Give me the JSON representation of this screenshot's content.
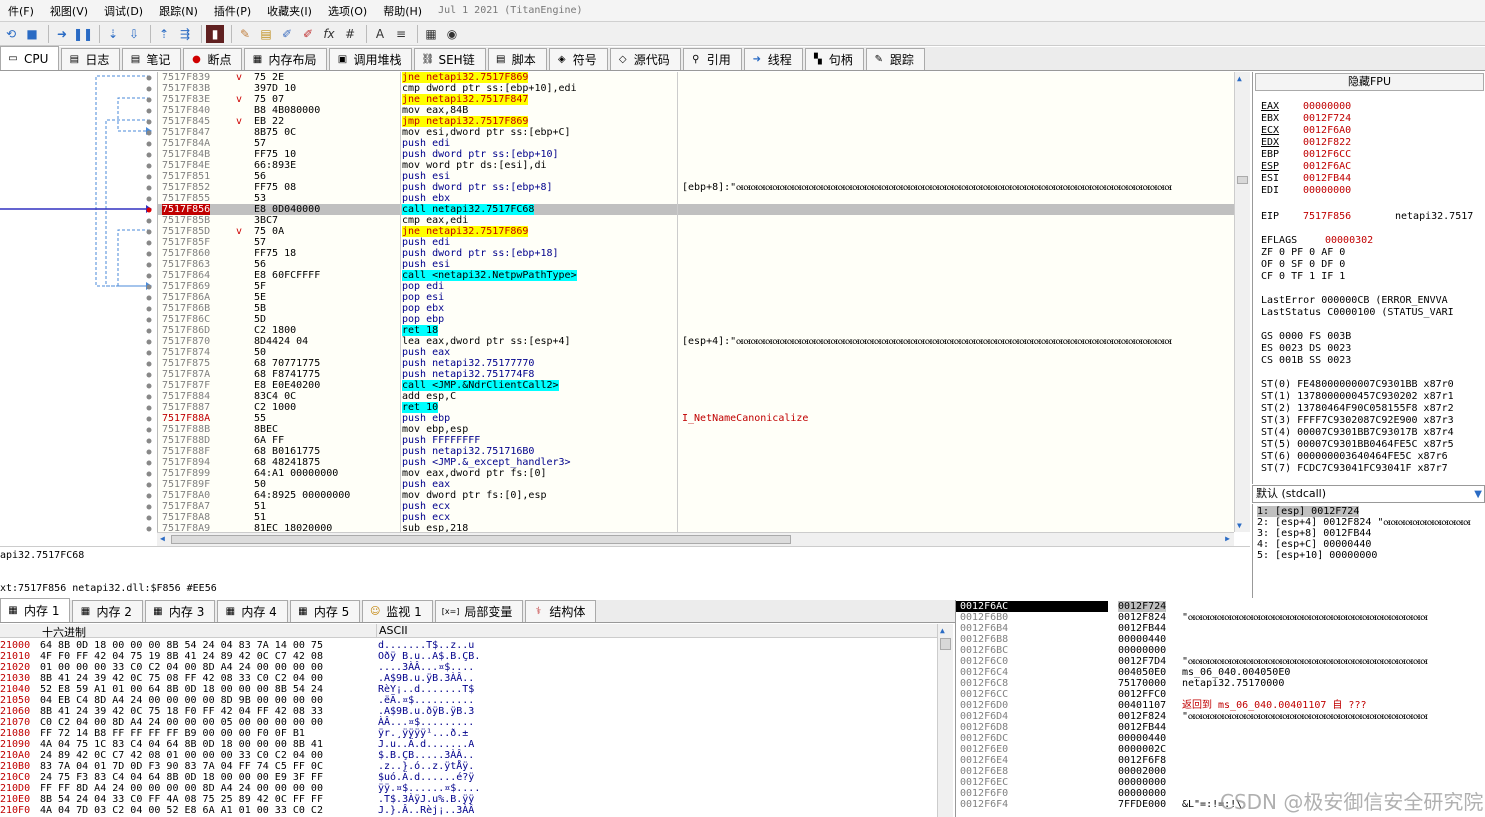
{
  "menu": [
    "件(F)",
    "视图(V)",
    "调试(D)",
    "跟踪(N)",
    "插件(P)",
    "收藏夹(I)",
    "选项(O)",
    "帮助(H)"
  ],
  "build_date": "Jul 1 2021 (TitanEngine)",
  "tabs": [
    {
      "icon": "cpu-icon",
      "label": "CPU"
    },
    {
      "icon": "log-icon",
      "label": "日志"
    },
    {
      "icon": "notes-icon",
      "label": "笔记"
    },
    {
      "icon": "breakpoint-icon",
      "label": "断点"
    },
    {
      "icon": "memory-map-icon",
      "label": "内存布局"
    },
    {
      "icon": "callstack-icon",
      "label": "调用堆栈"
    },
    {
      "icon": "seh-icon",
      "label": "SEH链"
    },
    {
      "icon": "script-icon",
      "label": "脚本"
    },
    {
      "icon": "symbol-icon",
      "label": "符号"
    },
    {
      "icon": "source-icon",
      "label": "源代码"
    },
    {
      "icon": "references-icon",
      "label": "引用"
    },
    {
      "icon": "threads-icon",
      "label": "线程"
    },
    {
      "icon": "handles-icon",
      "label": "句柄"
    },
    {
      "icon": "trace-icon",
      "label": "跟踪"
    }
  ],
  "disasm": [
    {
      "addr": "7517F839",
      "arrow": "v",
      "bytes": "75 2E",
      "instr": "jne netapi32.7517F869",
      "kind": "jcc",
      "cmt": ""
    },
    {
      "addr": "7517F83B",
      "arrow": "",
      "bytes": "397D 10",
      "instr": "cmp dword ptr ss:[ebp+10],edi",
      "kind": "norm",
      "cmt": ""
    },
    {
      "addr": "7517F83E",
      "arrow": "v",
      "bytes": "75 07",
      "instr": "jne netapi32.7517F847",
      "kind": "jcc",
      "cmt": ""
    },
    {
      "addr": "7517F840",
      "arrow": "",
      "bytes": "B8 4B080000",
      "instr": "mov eax,84B",
      "kind": "norm",
      "cmt": ""
    },
    {
      "addr": "7517F845",
      "arrow": "v",
      "bytes": "EB 22",
      "instr": "jmp netapi32.7517F869",
      "kind": "jcc",
      "cmt": ""
    },
    {
      "addr": "7517F847",
      "arrow": "",
      "bytes": "8B75 0C",
      "instr": "mov esi,dword ptr ss:[ebp+C]",
      "kind": "norm",
      "cmt": ""
    },
    {
      "addr": "7517F84A",
      "arrow": "",
      "bytes": "57",
      "instr": "push edi",
      "kind": "push",
      "cmt": ""
    },
    {
      "addr": "7517F84B",
      "arrow": "",
      "bytes": "FF75 10",
      "instr": "push dword ptr ss:[ebp+10]",
      "kind": "push",
      "cmt": ""
    },
    {
      "addr": "7517F84E",
      "arrow": "",
      "bytes": "66:893E",
      "instr": "mov word ptr ds:[esi],di",
      "kind": "norm",
      "cmt": ""
    },
    {
      "addr": "7517F851",
      "arrow": "",
      "bytes": "56",
      "instr": "push esi",
      "kind": "push",
      "cmt": ""
    },
    {
      "addr": "7517F852",
      "arrow": "",
      "bytes": "FF75 08",
      "instr": "push dword ptr ss:[ebp+8]",
      "kind": "push",
      "cmt": "[ebp+8]:\"ꮊꮊꮊꮊꮊꮊꮊꮊꮊꮊꮊꮊꮊꮊꮊꮊꮊꮊꮊꮊꮊꮊꮊꮊꮊꮊꮊꮊꮊꮊꮊꮊꮊꮊꮊꮊꮊꮊꮊꮊꮊꮊꮊꮊꮊꮊꮊꮊꮊꮊꮊꮊꮊꮊꮊꮊꮊꮊꮊꮊ"
    },
    {
      "addr": "7517F855",
      "arrow": "",
      "bytes": "53",
      "instr": "push ebx",
      "kind": "push",
      "cmt": ""
    },
    {
      "addr": "7517F856",
      "arrow": "",
      "bytes": "E8 0D040000",
      "instr": "call netapi32.7517FC68",
      "kind": "call",
      "cmt": "",
      "current": true
    },
    {
      "addr": "7517F85B",
      "arrow": "",
      "bytes": "3BC7",
      "instr": "cmp eax,edi",
      "kind": "norm",
      "cmt": ""
    },
    {
      "addr": "7517F85D",
      "arrow": "v",
      "bytes": "75 0A",
      "instr": "jne netapi32.7517F869",
      "kind": "jcc",
      "cmt": ""
    },
    {
      "addr": "7517F85F",
      "arrow": "",
      "bytes": "57",
      "instr": "push edi",
      "kind": "push",
      "cmt": ""
    },
    {
      "addr": "7517F860",
      "arrow": "",
      "bytes": "FF75 18",
      "instr": "push dword ptr ss:[ebp+18]",
      "kind": "push",
      "cmt": ""
    },
    {
      "addr": "7517F863",
      "arrow": "",
      "bytes": "56",
      "instr": "push esi",
      "kind": "push",
      "cmt": ""
    },
    {
      "addr": "7517F864",
      "arrow": "",
      "bytes": "E8 60FCFFFF",
      "instr": "call <netapi32.NetpwPathType>",
      "kind": "call",
      "cmt": ""
    },
    {
      "addr": "7517F869",
      "arrow": "",
      "bytes": "5F",
      "instr": "pop edi",
      "kind": "pop",
      "cmt": ""
    },
    {
      "addr": "7517F86A",
      "arrow": "",
      "bytes": "5E",
      "instr": "pop esi",
      "kind": "pop",
      "cmt": ""
    },
    {
      "addr": "7517F86B",
      "arrow": "",
      "bytes": "5B",
      "instr": "pop ebx",
      "kind": "pop",
      "cmt": ""
    },
    {
      "addr": "7517F86C",
      "arrow": "",
      "bytes": "5D",
      "instr": "pop ebp",
      "kind": "pop",
      "cmt": ""
    },
    {
      "addr": "7517F86D",
      "arrow": "",
      "bytes": "C2 1800",
      "instr": "ret 18",
      "kind": "ret",
      "cmt": ""
    },
    {
      "addr": "7517F870",
      "arrow": "",
      "bytes": "8D4424 04",
      "instr": "lea eax,dword ptr ss:[esp+4]",
      "kind": "norm",
      "cmt": "[esp+4]:\"ꮊꮊꮊꮊꮊꮊꮊꮊꮊꮊꮊꮊꮊꮊꮊꮊꮊꮊꮊꮊꮊꮊꮊꮊꮊꮊꮊꮊꮊꮊꮊꮊꮊꮊꮊꮊꮊꮊꮊꮊꮊꮊꮊꮊꮊꮊꮊꮊꮊꮊꮊꮊꮊꮊꮊꮊꮊꮊꮊꮊ"
    },
    {
      "addr": "7517F874",
      "arrow": "",
      "bytes": "50",
      "instr": "push eax",
      "kind": "push",
      "cmt": ""
    },
    {
      "addr": "7517F875",
      "arrow": "",
      "bytes": "68 70771775",
      "instr": "push netapi32.75177770",
      "kind": "push",
      "cmt": ""
    },
    {
      "addr": "7517F87A",
      "arrow": "",
      "bytes": "68 F8741775",
      "instr": "push netapi32.751774F8",
      "kind": "push",
      "cmt": ""
    },
    {
      "addr": "7517F87F",
      "arrow": "",
      "bytes": "E8 E0E40200",
      "instr": "call <JMP.&NdrClientCall2>",
      "kind": "call",
      "cmt": ""
    },
    {
      "addr": "7517F884",
      "arrow": "",
      "bytes": "83C4 0C",
      "instr": "add esp,C",
      "kind": "norm",
      "cmt": ""
    },
    {
      "addr": "7517F887",
      "arrow": "",
      "bytes": "C2 1000",
      "instr": "ret 10",
      "kind": "ret",
      "cmt": ""
    },
    {
      "addr": "7517F88A",
      "arrow": "",
      "bytes": "55",
      "instr": "push ebp",
      "kind": "push",
      "cmt": "I_NetNameCanonicalize",
      "addrRed": true
    },
    {
      "addr": "7517F88B",
      "arrow": "",
      "bytes": "8BEC",
      "instr": "mov ebp,esp",
      "kind": "norm",
      "cmt": ""
    },
    {
      "addr": "7517F88D",
      "arrow": "",
      "bytes": "6A FF",
      "instr": "push FFFFFFFF",
      "kind": "push",
      "cmt": ""
    },
    {
      "addr": "7517F88F",
      "arrow": "",
      "bytes": "68 B0161775",
      "instr": "push netapi32.751716B0",
      "kind": "push",
      "cmt": ""
    },
    {
      "addr": "7517F894",
      "arrow": "",
      "bytes": "68 48241875",
      "instr": "push <JMP.&_except_handler3>",
      "kind": "push",
      "cmt": ""
    },
    {
      "addr": "7517F899",
      "arrow": "",
      "bytes": "64:A1 00000000",
      "instr": "mov eax,dword ptr fs:[0]",
      "kind": "norm",
      "cmt": ""
    },
    {
      "addr": "7517F89F",
      "arrow": "",
      "bytes": "50",
      "instr": "push eax",
      "kind": "push",
      "cmt": ""
    },
    {
      "addr": "7517F8A0",
      "arrow": "",
      "bytes": "64:8925 00000000",
      "instr": "mov dword ptr fs:[0],esp",
      "kind": "norm",
      "cmt": ""
    },
    {
      "addr": "7517F8A7",
      "arrow": "",
      "bytes": "51",
      "instr": "push ecx",
      "kind": "push",
      "cmt": ""
    },
    {
      "addr": "7517F8A8",
      "arrow": "",
      "bytes": "51",
      "instr": "push ecx",
      "kind": "push",
      "cmt": ""
    },
    {
      "addr": "7517F8A9",
      "arrow": "",
      "bytes": "81EC 18020000",
      "instr": "sub esp,218",
      "kind": "norm",
      "cmt": ""
    }
  ],
  "info": {
    "line1": "api32.7517FC68",
    "line2": "xt:7517F856 netapi32.dll:$F856 #EE56"
  },
  "regs": {
    "header": "隐藏FPU",
    "gp": [
      {
        "n": "EAX",
        "v": "00000000",
        "ul": true
      },
      {
        "n": "EBX",
        "v": "0012F724",
        "ul": false
      },
      {
        "n": "ECX",
        "v": "0012F6A0",
        "ul": true
      },
      {
        "n": "EDX",
        "v": "0012F822",
        "ul": true
      },
      {
        "n": "EBP",
        "v": "0012F6CC",
        "ul": false
      },
      {
        "n": "ESP",
        "v": "0012F6AC",
        "ul": true
      },
      {
        "n": "ESI",
        "v": "0012FB44",
        "ul": false
      },
      {
        "n": "EDI",
        "v": "00000000",
        "ul": false
      }
    ],
    "eip": {
      "n": "EIP",
      "v": "7517F856",
      "sym": "netapi32.7517"
    },
    "eflags": {
      "n": "EFLAGS",
      "v": "00000302"
    },
    "flags": [
      "ZF 0  PF 0  AF 0",
      "OF 0  SF 0  DF 0",
      "CF 0  TF 1  IF 1"
    ],
    "lasterror": "LastError  000000CB (ERROR_ENVVA",
    "laststatus": "LastStatus C0000100 (STATUS_VARI",
    "segs": [
      "GS 0000  FS 003B",
      "ES 0023  DS 0023",
      "CS 001B  SS 0023"
    ],
    "st": [
      "ST(0) FE48000000007C9301BB x87r0",
      "ST(1) 1378000000457C930202 x87r1",
      "ST(2) 13780464F90C058155F8 x87r2",
      "ST(3) FFFF7C9302087C92E900 x87r3",
      "ST(4) 00007C9301BB7C93017B x87r4",
      "ST(5) 00007C9301BB0464FE5C x87r5",
      "ST(6) 000000003640464FE5C x87r6",
      "ST(7) FCDC7C93041FC93041F x87r7"
    ]
  },
  "callconv": "默认 (stdcall)",
  "args": [
    "1: [esp] 0012F724",
    "2: [esp+4] 0012F824 \"ꮊꮊꮊꮊꮊꮊꮊꮊꮊꮊꮊꮊ",
    "3: [esp+8] 0012FB44",
    "4: [esp+C] 00000440",
    "5: [esp+10] 00000000"
  ],
  "dumptabs": [
    {
      "icon": "memory-icon",
      "label": "内存 1"
    },
    {
      "icon": "memory-icon",
      "label": "内存 2"
    },
    {
      "icon": "memory-icon",
      "label": "内存 3"
    },
    {
      "icon": "memory-icon",
      "label": "内存 4"
    },
    {
      "icon": "memory-icon",
      "label": "内存 5"
    },
    {
      "icon": "watch-icon",
      "label": "监视 1"
    },
    {
      "icon": "locals-icon",
      "label": "局部变量"
    },
    {
      "icon": "struct-icon",
      "label": "结构体"
    }
  ],
  "dumphead": {
    "hex": "十六进制",
    "ascii": "ASCII"
  },
  "dump": [
    {
      "a": "21000",
      "h": "64 8B 0D 18 00 00 00 8B 54 24 04 83 7A 14 00 75",
      "s": "d.......T$..z..u"
    },
    {
      "a": "21010",
      "h": "4F F0 FF 42 04 75 19 8B 41 24 89 42 0C C7 42 08",
      "s": "Oðÿ B.u..A$.B.ÇB."
    },
    {
      "a": "21020",
      "h": "01 00 00 00 33 C0 C2 04 00 8D A4 24 00 00 00 00",
      "s": "....3ÀÂ...¤$...."
    },
    {
      "a": "21030",
      "h": "8B 41 24 39 42 0C 75 08 FF 42 08 33 C0 C2 04 00",
      "s": ".A$9B.u.ÿB.3ÀÂ.."
    },
    {
      "a": "21040",
      "h": "52 E8 59 A1 01 00 64 8B 0D 18 00 00 00 8B 54 24",
      "s": "RèY¡..d.......T$"
    },
    {
      "a": "21050",
      "h": "04 EB C4 8D A4 24 00 00 00 00 8D 9B 00 00 00 00",
      "s": ".ëÄ.¤$.........."
    },
    {
      "a": "21060",
      "h": "8B 41 24 39 42 0C 75 18 F0 FF 42 04 FF 42 08 33",
      "s": ".A$9B.u.ðÿB.ÿB.3"
    },
    {
      "a": "21070",
      "h": "C0 C2 04 00 8D A4 24 00 00 00 05 00 00 00 00 00",
      "s": "ÀÂ...¤$........."
    },
    {
      "a": "21080",
      "h": "FF 72 14 B8 FF FF FF FF B9 00 00 00 F0 0F B1",
      "s": "ÿr.¸ÿÿÿÿ¹...ð.±"
    },
    {
      "a": "21090",
      "h": "4A 04 75 1C 83 C4 04 64 8B 0D 18 00 00 00 8B 41",
      "s": "J.u..Ä.d.......A"
    },
    {
      "a": "210A0",
      "h": "24 89 42 0C C7 42 08 01 00 00 00 33 C0 C2 04 00",
      "s": "$.B.ÇB.....3ÀÂ.."
    },
    {
      "a": "210B0",
      "h": "83 7A 04 01 7D 0D F3 90 83 7A 04 FF 74 C5 FF 0C",
      "s": ".z..}.ó..z.ÿtÅÿ."
    },
    {
      "a": "210C0",
      "h": "24 75 F3 83 C4 04 64 8B 0D 18 00 00 00 E9 3F FF",
      "s": "$uó.Ä.d......é?ÿ"
    },
    {
      "a": "210D0",
      "h": "FF FF 8D A4 24 00 00 00 00 8D A4 24 00 00 00 00",
      "s": "ÿÿ.¤$......¤$...."
    },
    {
      "a": "210E0",
      "h": "8B 54 24 04 33 C0 FF 4A 08 75 25 89 42 0C FF FF",
      "s": ".T$.3ÀÿJ.u%.B.ÿÿ"
    },
    {
      "a": "210F0",
      "h": "4A 04 7D 03 C2 04 00 52 E8 6A A1 01 00 33 C0 C2",
      "s": "J.}.Â..Rèj¡..3ÀÂ"
    }
  ],
  "stack": [
    {
      "a": "0012F6AC",
      "v": "0012F724",
      "c": "",
      "sel": true
    },
    {
      "a": "0012F6B0",
      "v": "0012F824",
      "c": "\"ꮊꮊꮊꮊꮊꮊꮊꮊꮊꮊꮊꮊꮊꮊꮊꮊꮊꮊꮊꮊꮊꮊꮊꮊꮊꮊꮊꮊꮊꮊꮊꮊꮊ"
    },
    {
      "a": "0012F6B4",
      "v": "0012FB44",
      "c": ""
    },
    {
      "a": "0012F6B8",
      "v": "00000440",
      "c": ""
    },
    {
      "a": "0012F6BC",
      "v": "00000000",
      "c": ""
    },
    {
      "a": "0012F6C0",
      "v": "0012F7D4",
      "c": "\"ꮊꮊꮊꮊꮊꮊꮊꮊꮊꮊꮊꮊꮊꮊꮊꮊꮊꮊꮊꮊꮊꮊꮊꮊꮊꮊꮊꮊꮊꮊꮊꮊꮊ"
    },
    {
      "a": "0012F6C4",
      "v": "004050E0",
      "c": "ms_06_040.004050E0"
    },
    {
      "a": "0012F6C8",
      "v": "75170000",
      "c": "netapi32.75170000"
    },
    {
      "a": "0012F6CC",
      "v": "0012FFC0",
      "c": ""
    },
    {
      "a": "0012F6D0",
      "v": "00401107",
      "c": "返回到 ms_06_040.00401107 自 ???",
      "red": true
    },
    {
      "a": "0012F6D4",
      "v": "0012F824",
      "c": "\"ꮊꮊꮊꮊꮊꮊꮊꮊꮊꮊꮊꮊꮊꮊꮊꮊꮊꮊꮊꮊꮊꮊꮊꮊꮊꮊꮊꮊꮊꮊꮊꮊꮊ"
    },
    {
      "a": "0012F6D8",
      "v": "0012FB44",
      "c": ""
    },
    {
      "a": "0012F6DC",
      "v": "00000440",
      "c": ""
    },
    {
      "a": "0012F6E0",
      "v": "0000002C",
      "c": ""
    },
    {
      "a": "0012F6E4",
      "v": "0012F6F8",
      "c": ""
    },
    {
      "a": "0012F6E8",
      "v": "00002000",
      "c": ""
    },
    {
      "a": "0012F6EC",
      "v": "00000000",
      "c": ""
    },
    {
      "a": "0012F6F0",
      "v": "00000000",
      "c": ""
    },
    {
      "a": "0012F6F4",
      "v": "7FFDE000",
      "c": "&L\"=:!=:!\\"
    }
  ],
  "watermark": "CSDN @极安御信安全研究院"
}
